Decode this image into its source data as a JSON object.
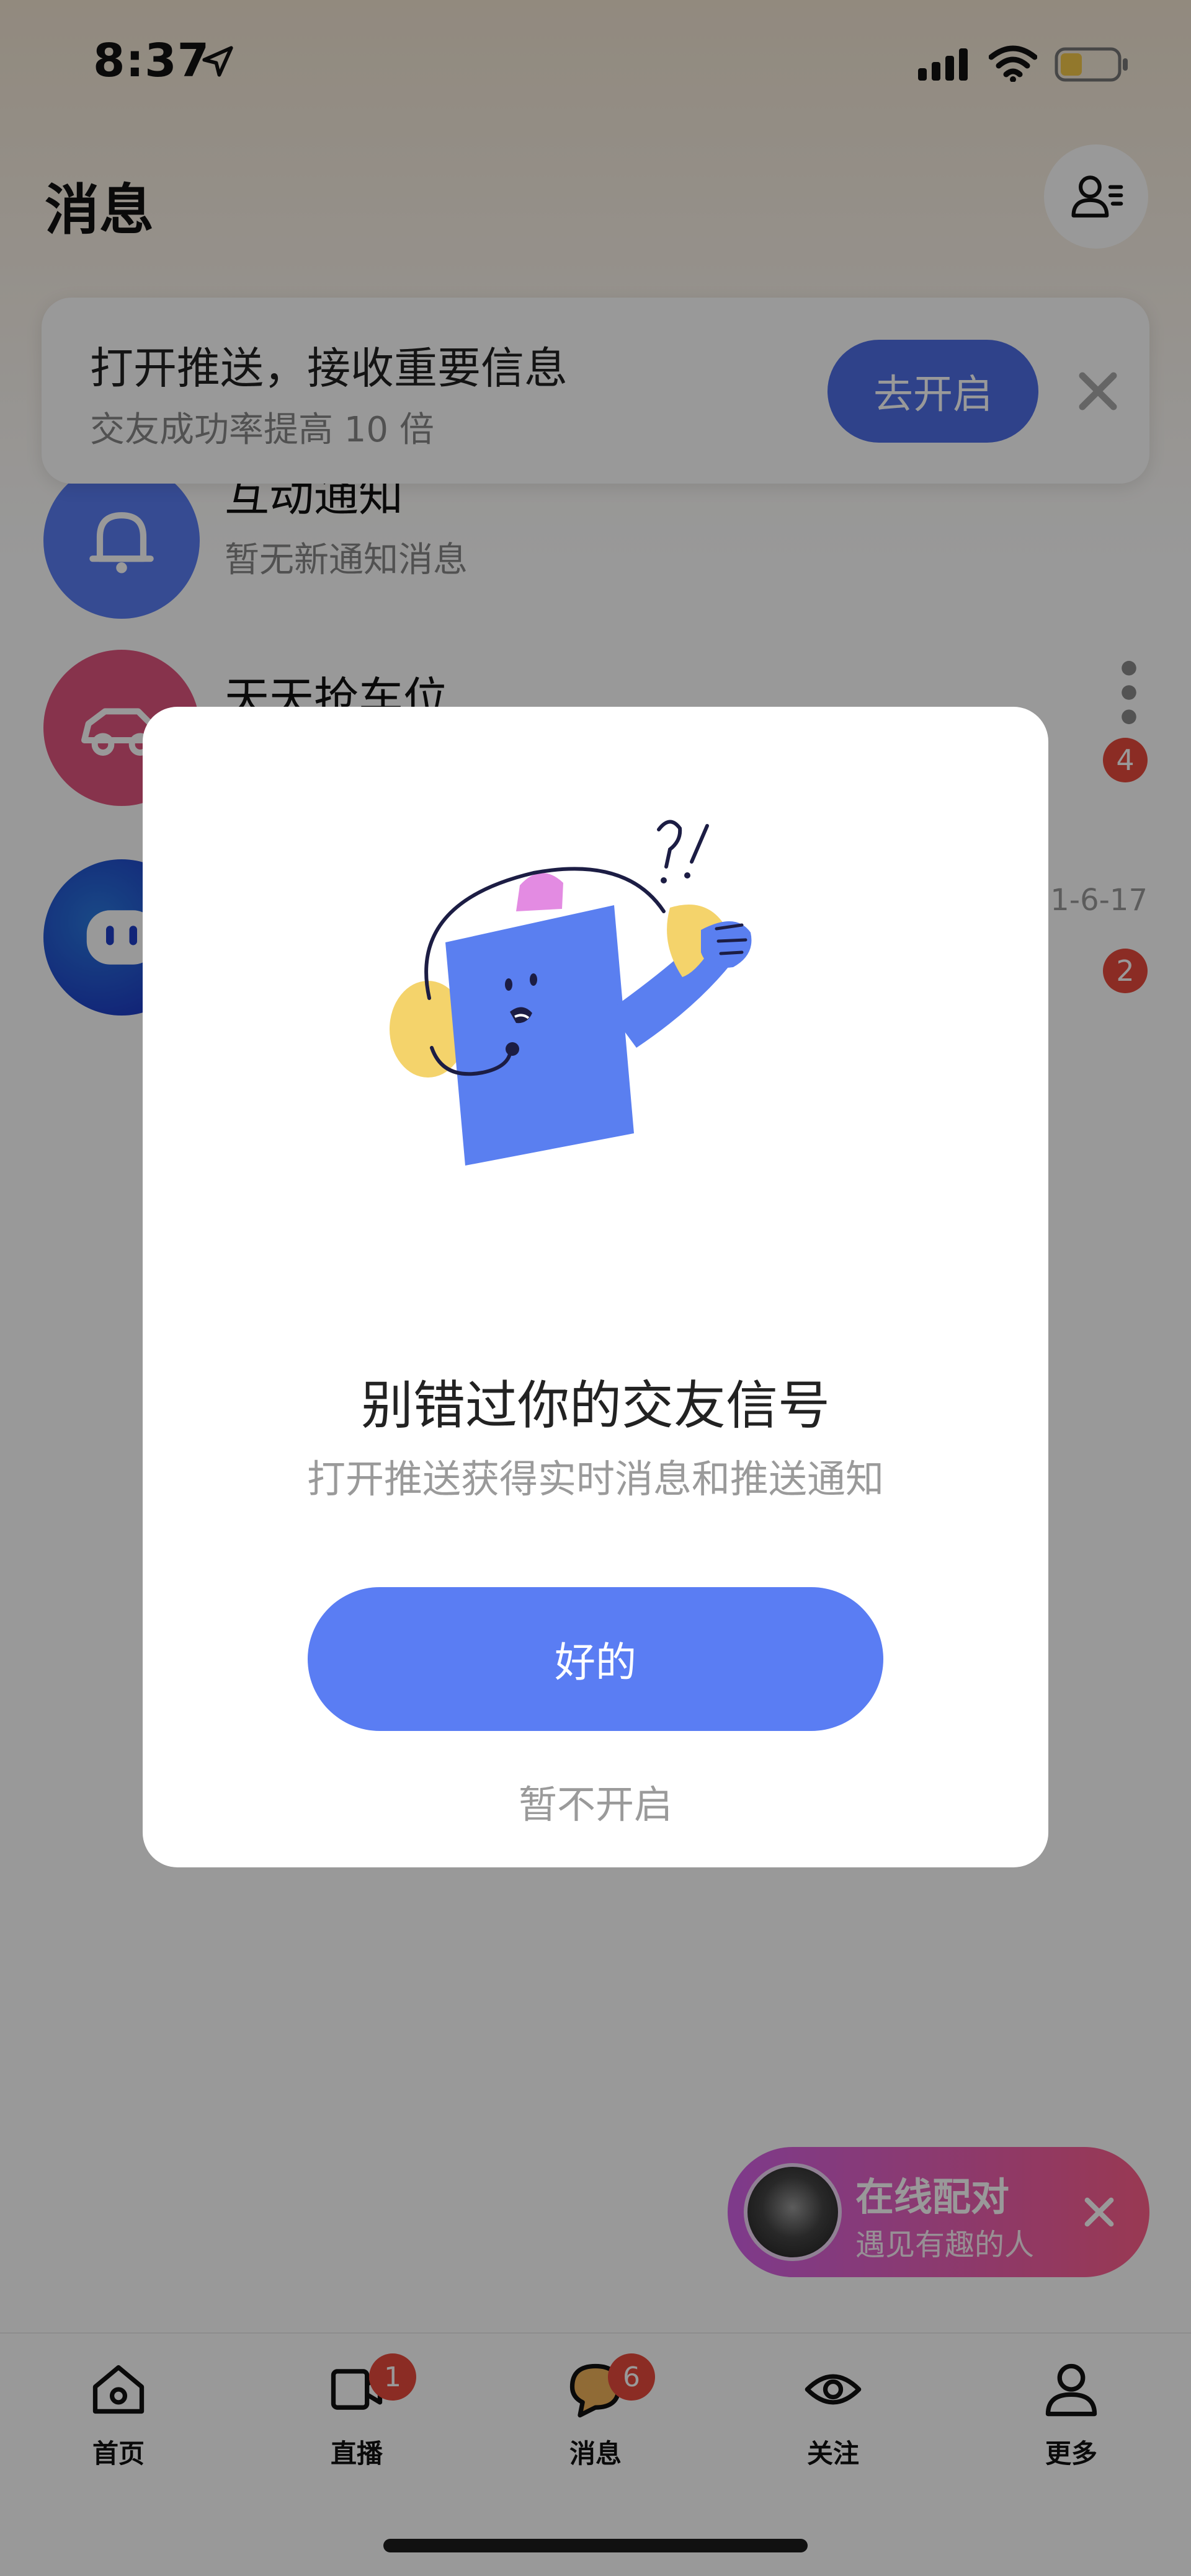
{
  "status_bar": {
    "time": "8:37"
  },
  "header": {
    "title": "消息"
  },
  "push_banner": {
    "title": "打开推送，接收重要信息",
    "subtitle": "交友成功率提高 10 倍",
    "enable_label": "去开启"
  },
  "list": [
    {
      "name": "互动通知",
      "preview": "暂无新通知消息",
      "time": "",
      "badge": ""
    },
    {
      "name": "天天抢车位",
      "preview": "",
      "time": "",
      "badge": "4"
    },
    {
      "name": "",
      "preview": "",
      "time": "1-6-17",
      "badge": "2"
    }
  ],
  "match": {
    "title": "在线配对",
    "subtitle": "遇见有趣的人"
  },
  "tabs": [
    {
      "label": "首页",
      "badge": ""
    },
    {
      "label": "直播",
      "badge": "1"
    },
    {
      "label": "消息",
      "badge": "6"
    },
    {
      "label": "关注",
      "badge": ""
    },
    {
      "label": "更多",
      "badge": ""
    }
  ],
  "modal": {
    "title": "别错过你的交友信号",
    "subtitle": "打开推送获得实时消息和推送通知",
    "ok_label": "好的",
    "later_label": "暂不开启"
  },
  "colors": {
    "accent": "#5a7df3",
    "banner_button": "#4f6fe6",
    "badge": "#e84a3c",
    "match_gradient_start": "#d262e8",
    "match_gradient_end": "#ff5f8a",
    "overlay": "rgba(0,0,0,0.40)"
  }
}
